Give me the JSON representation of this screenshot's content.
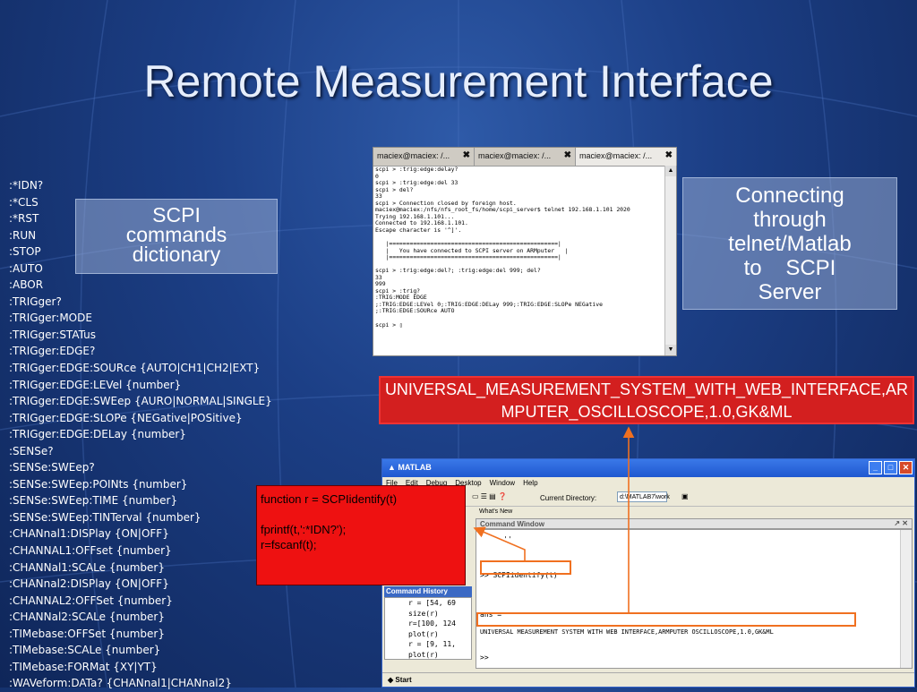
{
  "slide": {
    "title": "Remote Measurement Interface"
  },
  "scpi_commands": [
    ":*IDN?",
    ":*CLS",
    ":*RST",
    ":RUN",
    ":STOP",
    ":AUTO",
    ":ABOR",
    ":TRIGger?",
    ":TRIGger:MODE",
    ":TRIGger:STATus",
    ":TRIGger:EDGE?",
    ":TRIGger:EDGE:SOURce {AUTO|CH1|CH2|EXT}",
    ":TRIGger:EDGE:LEVel {number}",
    ":TRIGger:EDGE:SWEep {AURO|NORMAL|SINGLE}",
    ":TRIGger:EDGE:SLOPe {NEGative|POSitive}",
    ":TRIGger:EDGE:DELay {number}",
    ":SENSe?",
    ":SENSe:SWEep?",
    ":SENSe:SWEep:POINts {number}",
    ":SENSe:SWEep:TIME {number}",
    ":SENSe:SWEep:TINTerval {number}",
    ":CHANnal1:DISPlay {ON|OFF}",
    ":CHANNAL1:OFFset {number}",
    ":CHANNal1:SCALe {number}",
    ":CHANnal2:DISPlay {ON|OFF}",
    ":CHANNAL2:OFFSet {number}",
    ":CHANNal2:SCALe {number}",
    ":TIMebase:OFFSet {number}",
    ":TIMebase:SCALe {number}",
    ":TIMebase:FORMat {XY|YT}",
    ":WAVeform:DATa? {CHANnal1|CHANnal2}"
  ],
  "scpi_label": {
    "line1": "SCPI",
    "line2": "commands",
    "line3": "dictionary"
  },
  "connect_label": {
    "line1": "Connecting",
    "line2": "through",
    "line3": "telnet/Matlab",
    "line4": "to    SCPI",
    "line5": "Server"
  },
  "terminal": {
    "tabs": [
      {
        "label": "maciex@maciex: /...",
        "close": "✖"
      },
      {
        "label": "maciex@maciex: /...",
        "close": "✖"
      },
      {
        "label": "maciex@maciex: /...",
        "close": "✖"
      }
    ],
    "lines": [
      "scpi > :trig:edge:delay?",
      "0",
      "scpi > :trig:edge:del 33",
      "scpi > del?",
      "33",
      "scpi > Connection closed by foreign host.",
      "maciex@maciex:/nfs/nfs_root_fs/home/scpi_server$ telnet 192.168.1.101 2020",
      "Trying 192.168.1.101...",
      "Connected to 192.168.1.101.",
      "Escape character is '^]'.",
      "",
      "   |=================================================|",
      "   |   You have connected to SCPI server on ARMputer   |",
      "   |=================================================|",
      "",
      "scpi > :trig:edge:del?; :trig:edge:del 999; del?",
      "33",
      "999",
      "scpi > :trig?",
      ":TRIG:MODE EDGE",
      ";:TRIG:EDGE:LEVel 0;:TRIG:EDGE:DELay 999;:TRIG:EDGE:SLOPe NEGative",
      ";:TRIG:EDGE:SOURce AUTO",
      "",
      "scpi > ▯"
    ]
  },
  "result_banner": "UNIVERSAL_MEASUREMENT_SYSTEM_WITH_WEB_INTERFACE,ARMPUTER_OSCILLOSCOPE,1.0,GK&ML",
  "matlab": {
    "title": "MATLAB",
    "menu": [
      "File",
      "Edit",
      "Debug",
      "Desktop",
      "Window",
      "Help"
    ],
    "current_dir_label": "Current Directory:",
    "current_dir_value": "d:\\MATLAB7\\work",
    "shortcuts": "What's New",
    "command_window_title": "Command Window",
    "command_history_title": "Command History",
    "cmd_lines": {
      "quote": "''",
      "call": ">> SCPIidentify(t)",
      "ans": "ans =",
      "result": "UNIVERSAL MEASUREMENT SYSTEM WITH WEB INTERFACE,ARMPUTER OSCILLOSCOPE,1.0,GK&ML",
      "prompt": ">>"
    },
    "history": [
      "r = [54, 69",
      "size(r)",
      "r=[100, 124",
      "plot(r)",
      "r = [9, 11,",
      "plot(r)"
    ],
    "start_label": "Start"
  },
  "function_box": {
    "line1": "function r = SCPIidentify(t)",
    "line2": "fprintf(t,':*IDN?');",
    "line3": "r=fscanf(t);"
  },
  "colors": {
    "background": "#1c3f86",
    "accent_red": "#d31f1f",
    "highlight_orange": "#f07020"
  }
}
